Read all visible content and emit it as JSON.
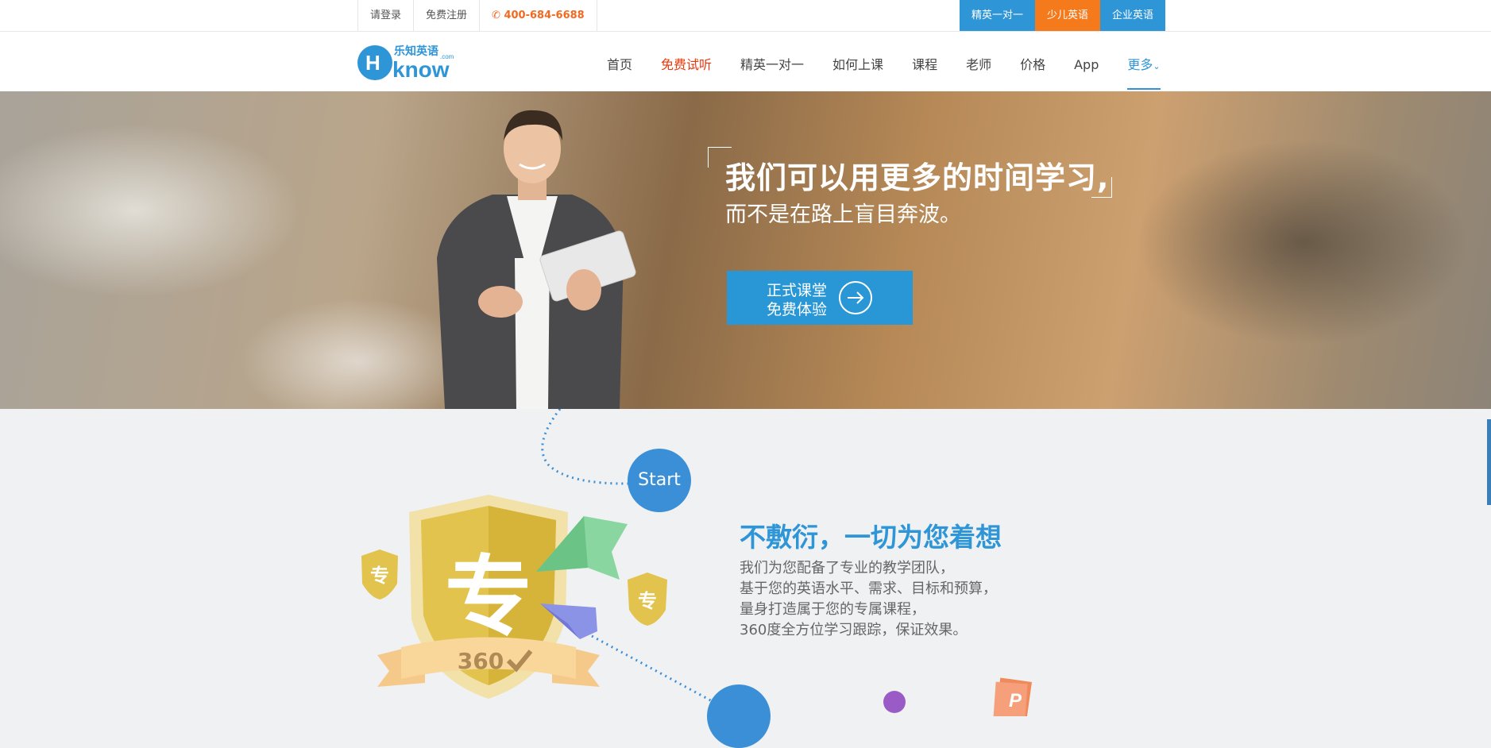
{
  "topbar": {
    "login": "请登录",
    "register": "免费注册",
    "phone": "400-684-6688",
    "tabs": [
      {
        "label": "精英一对一",
        "color": "#2e95d7"
      },
      {
        "label": "少儿英语",
        "color": "#f57a1c"
      },
      {
        "label": "企业英语",
        "color": "#2e95d7"
      }
    ]
  },
  "logo": {
    "brand_cn": "乐知英语",
    "brand_en": "know",
    "suffix": ".com"
  },
  "nav": {
    "items": [
      {
        "label": "首页"
      },
      {
        "label": "免费试听"
      },
      {
        "label": "精英一对一"
      },
      {
        "label": "如何上课"
      },
      {
        "label": "课程"
      },
      {
        "label": "老师"
      },
      {
        "label": "价格"
      },
      {
        "label": "App"
      },
      {
        "label": "更多"
      }
    ],
    "active": "更多"
  },
  "hero": {
    "title": "我们可以用更多的时间学习,",
    "subtitle": "而不是在路上盲目奔波。",
    "cta_line1": "正式课堂",
    "cta_line2": "免费体验"
  },
  "feature": {
    "start_label": "Start",
    "badge_char": "专",
    "badge_small": "专",
    "badge_number": "360",
    "title": "不敷衍，一切为您着想",
    "lines": [
      "我们为您配备了专业的教学团队，",
      "基于您的英语水平、需求、目标和预算，",
      "量身打造属于您的专属课程，",
      "360度全方位学习跟踪，保证效果。"
    ],
    "book_letter": "P"
  },
  "colors": {
    "brand_blue": "#2e95d7",
    "brand_orange": "#f57a1c",
    "nav_red": "#e8380d"
  }
}
